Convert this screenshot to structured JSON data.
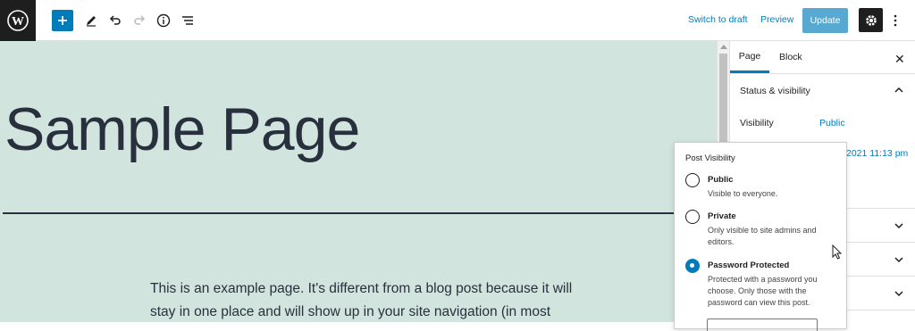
{
  "toolbar": {
    "switch_to_draft": "Switch to draft",
    "preview": "Preview",
    "update": "Update",
    "accent_color": "#007cba"
  },
  "icons": [
    "wordpress-logo",
    "plus",
    "pencil",
    "undo",
    "redo",
    "info",
    "list-view",
    "gear",
    "more-vertical",
    "close",
    "chevron-up",
    "chevron-down"
  ],
  "editor": {
    "title": "Sample Page",
    "paragraph": "This is an example page. It's different from a blog post because it will stay in one place and will show up in your site navigation (in most",
    "background": "#d1e4dd"
  },
  "sidebar": {
    "tabs": [
      "Page",
      "Block"
    ],
    "panel_title": "Status & visibility",
    "visibility_label": "Visibility",
    "visibility_value": "Public",
    "publish_date": "2021 11:13 pm"
  },
  "popover": {
    "title": "Post Visibility",
    "options": [
      {
        "label": "Public",
        "description": "Visible to everyone.",
        "selected": false
      },
      {
        "label": "Private",
        "description": "Only visible to site admins and editors.",
        "selected": false
      },
      {
        "label": "Password Protected",
        "description": "Protected with a password you choose. Only those with the password can view this post.",
        "selected": true
      }
    ]
  }
}
